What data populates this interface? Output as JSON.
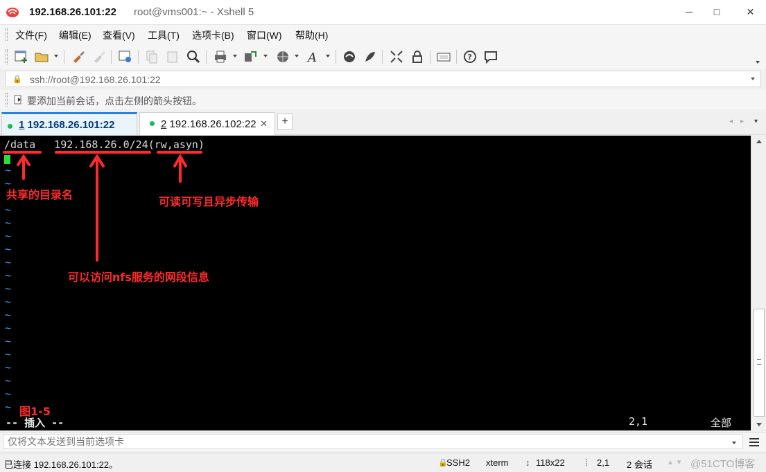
{
  "window": {
    "host": "192.168.26.101:22",
    "subtitle": "root@vms001:~ - Xshell 5",
    "minimize": "─",
    "maximize": "□",
    "close": "✕"
  },
  "menu": [
    "文件(F)",
    "编辑(E)",
    "查看(V)",
    "工具(T)",
    "选项卡(B)",
    "窗口(W)",
    "帮助(H)"
  ],
  "address": {
    "lock_icon": "🔒",
    "value": "ssh://root@192.168.26.101:22"
  },
  "hint": "要添加当前会话，点击左侧的箭头按钮。",
  "tabs": [
    {
      "num": "1",
      "label": "192.168.26.101:22",
      "active": true
    },
    {
      "num": "2",
      "label": "192.168.26.102:22",
      "active": false
    }
  ],
  "tab_add": "+",
  "tab_close": "✕",
  "tab_nav": [
    "◂",
    "▸",
    "▾"
  ],
  "terminal": {
    "line1": "/data   192.168.26.0/24(rw,asyn)",
    "tilde": "~",
    "mode": "-- 插入 --",
    "position": "2,1",
    "scroll": "全部"
  },
  "annotations": {
    "dir": "共享的目录名",
    "rw": "可读可写且异步传输",
    "net": "可以访问nfs服务的网段信息",
    "fig": "图1-5"
  },
  "input": {
    "placeholder": "仅将文本发送到当前选项卡"
  },
  "status": {
    "connected": "已连接 192.168.26.101:22。",
    "protocol": "SSH2",
    "term": "xterm",
    "size": "118x22",
    "cursor": "2,1",
    "sessions": "2 会话",
    "arrows": "▲ ▼",
    "caps": "CAP",
    "num": "NUM",
    "watermark": "@51CTO博客"
  }
}
